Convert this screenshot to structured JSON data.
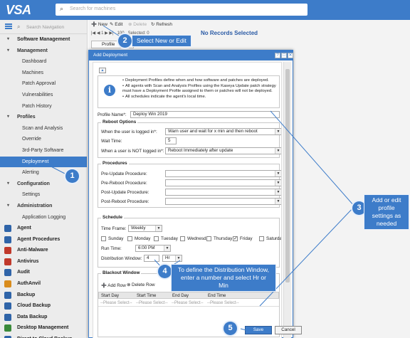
{
  "app": {
    "logo": "VSA",
    "search_placeholder": "Search for machines"
  },
  "sidebar": {
    "search_placeholder": "Search Navigation",
    "items": [
      {
        "label": "Software Management",
        "level": 0,
        "chev": "▾"
      },
      {
        "label": "Management",
        "level": 1,
        "chev": "▾"
      },
      {
        "label": "Dashboard",
        "level": 2
      },
      {
        "label": "Machines",
        "level": 2
      },
      {
        "label": "Patch Approval",
        "level": 2
      },
      {
        "label": "Vulnerabilities",
        "level": 2
      },
      {
        "label": "Patch History",
        "level": 2
      },
      {
        "label": "Profiles",
        "level": 1,
        "chev": "▾"
      },
      {
        "label": "Scan and Analysis",
        "level": 2
      },
      {
        "label": "Override",
        "level": 2
      },
      {
        "label": "3rd-Party Software",
        "level": 2
      },
      {
        "label": "Deployment",
        "level": 2,
        "active": true
      },
      {
        "label": "Alerting",
        "level": 2
      },
      {
        "label": "Configuration",
        "level": 1,
        "chev": "▾"
      },
      {
        "label": "Settings",
        "level": 2
      },
      {
        "label": "Administration",
        "level": 1,
        "chev": "▾"
      },
      {
        "label": "Application Logging",
        "level": 2
      },
      {
        "label": "Agent",
        "level": 0,
        "mod": "blue"
      },
      {
        "label": "Agent Procedures",
        "level": 0,
        "mod": "blue"
      },
      {
        "label": "Anti-Malware",
        "level": 0,
        "mod": "red"
      },
      {
        "label": "Antivirus",
        "level": 0,
        "mod": "red"
      },
      {
        "label": "Audit",
        "level": 0,
        "mod": "blue"
      },
      {
        "label": "AuthAnvil",
        "level": 0,
        "mod": "orange"
      },
      {
        "label": "Backup",
        "level": 0,
        "mod": "blue"
      },
      {
        "label": "Cloud Backup",
        "level": 0,
        "mod": "blue"
      },
      {
        "label": "Data Backup",
        "level": 0,
        "mod": "blue"
      },
      {
        "label": "Desktop Management",
        "level": 0,
        "mod": "green"
      },
      {
        "label": "Direct to Cloud Backup",
        "level": 0,
        "mod": "blue"
      }
    ]
  },
  "toolbar": {
    "new": "New",
    "edit": "Edit",
    "delete": "Delete",
    "refresh": "Refresh"
  },
  "pager": {
    "page": "1",
    "page_size": "100",
    "selected": "Selected: 0"
  },
  "main": {
    "no_records": "No Records Selected",
    "grid_col": "Profile"
  },
  "dialog": {
    "title": "Add Deployment",
    "info": [
      "Deployment Profiles define when and how software and patches are deployed.",
      "All agents with Scan and Analysis Profiles using the Kaseya Update patch strategy must have a Deployment Profile assigned to them or patches will not be deployed.",
      "All schedules indicate the agent's local time."
    ],
    "profile_name_label": "Profile Name*:",
    "profile_name_value": "Deploy Win 2019",
    "reboot": {
      "legend": "Reboot Options",
      "logged_in_label": "When the user is logged in*:",
      "logged_in_value": "Warn user and wait for x min and then reboot",
      "wait_time_label": "Wait Time:",
      "wait_time_value": "5",
      "not_logged_in_label": "When a user is NOT logged in*:",
      "not_logged_in_value": "Reboot Immediately after update"
    },
    "procedures": {
      "legend": "Procedures",
      "rows": [
        "Pre-Update Procedure:",
        "Pre-Reboot Procedure:",
        "Post-Update Procedure:",
        "Post-Reboot Procedure:"
      ]
    },
    "schedule": {
      "legend": "Schedule",
      "time_frame_label": "Time Frame:",
      "time_frame_value": "Weekly",
      "days": [
        "Sunday",
        "Monday",
        "Tuesday",
        "Wednesday",
        "Thursday",
        "Friday",
        "Saturday"
      ],
      "checked_day": "Friday",
      "run_time_label": "Run Time:",
      "run_time_value": "6:00 PM",
      "window_label": "Distribution Window:",
      "window_value": "4",
      "window_unit": "Hr"
    },
    "blackout": {
      "legend": "Blackout Window",
      "add_row": "Add Row",
      "delete_row": "Delete Row",
      "columns": [
        "Start Day",
        "Start Time",
        "End Day",
        "End Time"
      ],
      "placeholder": "--Please Select--"
    },
    "save": "Save",
    "cancel": "Cancel"
  },
  "callouts": {
    "c1": "1",
    "c2": "2",
    "c2_text": "Select New or Edit",
    "c3": "3",
    "c3_text": "Add or edit profile settings as needed",
    "c4": "4",
    "c4_text": "To define the Distribution Window, enter a number and select Hr or Min",
    "c5": "5"
  },
  "colors": {
    "accent": "#3d7cc9",
    "sidebar_bg": "#ececec"
  }
}
